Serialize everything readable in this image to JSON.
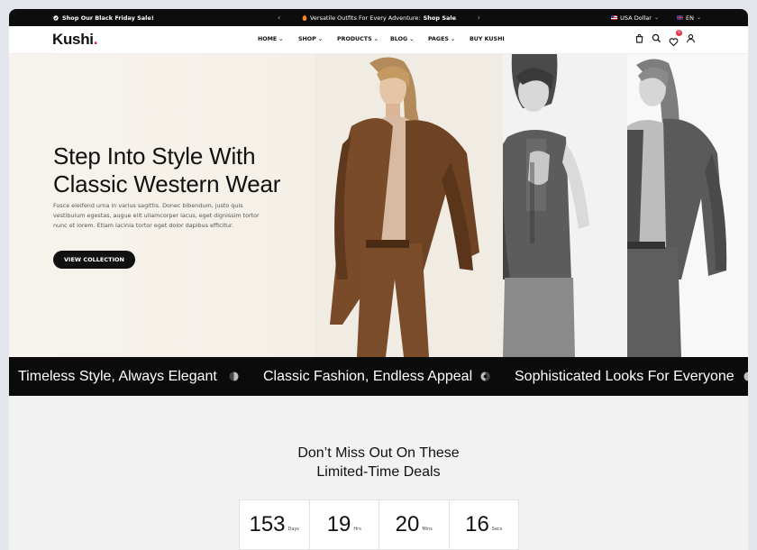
{
  "topbar": {
    "promo_left": "Shop Our Black Friday Sale!",
    "promo_center": "Versatile Outfits For Every Adventure:",
    "promo_link": "Shop Sale",
    "currency": "USA Dollar",
    "language": "EN"
  },
  "header": {
    "logo": "Kushi",
    "logo_dot": ".",
    "nav": [
      "HOME",
      "SHOP",
      "PRODUCTS",
      "BLOG",
      "PAGES",
      "BUY KUSHI"
    ],
    "wishlist_count": "0"
  },
  "hero": {
    "title_line1": "Step Into Style With",
    "title_line2": "Classic Western Wear",
    "description": "Fusce eleifend urna in varius sagittis. Donec bibendum, justo quis vestibulum egestas, augue elit ullamcorper lacus, eget dignissim tortor nunc et lorem. Etiam lacinia tortor eget dolor dapibus efficitur.",
    "cta": "VIEW COLLECTION"
  },
  "marquee": {
    "items": [
      "Timeless Style, Always Elegant",
      "Classic Fashion, Endless Appeal",
      "Sophisticated Looks For Everyone"
    ]
  },
  "deals": {
    "title_line1": "Don’t Miss Out On These",
    "title_line2": "Limited-Time Deals",
    "countdown": [
      {
        "value": "153",
        "unit": "Days"
      },
      {
        "value": "19",
        "unit": "Hrs"
      },
      {
        "value": "20",
        "unit": "Mins"
      },
      {
        "value": "16",
        "unit": "Secs"
      }
    ]
  },
  "colors": {
    "accent": "#d92330",
    "dark": "#0d0d0d",
    "badge": "#e8334a"
  }
}
